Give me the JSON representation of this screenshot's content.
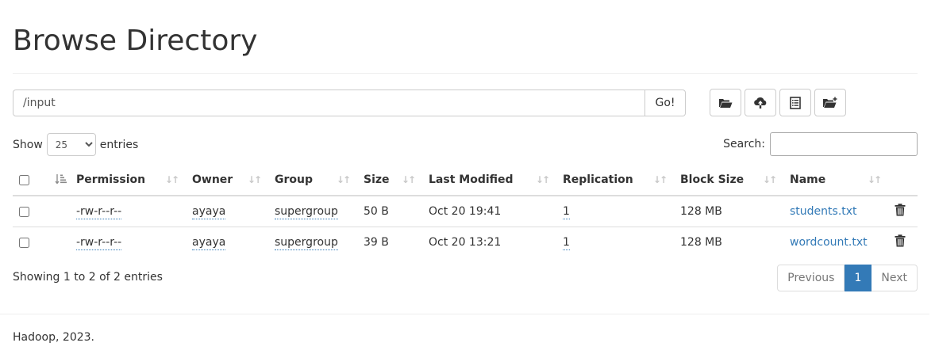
{
  "page": {
    "title": "Browse Directory"
  },
  "path": {
    "value": "/input",
    "go_label": "Go!"
  },
  "toolbar": {
    "icons": [
      "folder-open-icon",
      "cloud-upload-icon",
      "list-alt-icon",
      "new-folder-icon"
    ]
  },
  "length": {
    "show_label": "Show",
    "selected": "25",
    "entries_label": "entries"
  },
  "search": {
    "label": "Search:",
    "value": ""
  },
  "table": {
    "columns": [
      "Permission",
      "Owner",
      "Group",
      "Size",
      "Last Modified",
      "Replication",
      "Block Size",
      "Name"
    ],
    "rows": [
      {
        "permission": "-rw-r--r--",
        "owner": "ayaya",
        "group": "supergroup",
        "size": "50 B",
        "modified": "Oct 20 19:41",
        "replication": "1",
        "block_size": "128 MB",
        "name": "students.txt"
      },
      {
        "permission": "-rw-r--r--",
        "owner": "ayaya",
        "group": "supergroup",
        "size": "39 B",
        "modified": "Oct 20 13:21",
        "replication": "1",
        "block_size": "128 MB",
        "name": "wordcount.txt"
      }
    ]
  },
  "info": {
    "text": "Showing 1 to 2 of 2 entries"
  },
  "pagination": {
    "previous": "Previous",
    "page": "1",
    "next": "Next"
  },
  "footer": {
    "text": "Hadoop, 2023."
  },
  "colors": {
    "link": "#337ab7",
    "active_page": "#337ab7"
  }
}
